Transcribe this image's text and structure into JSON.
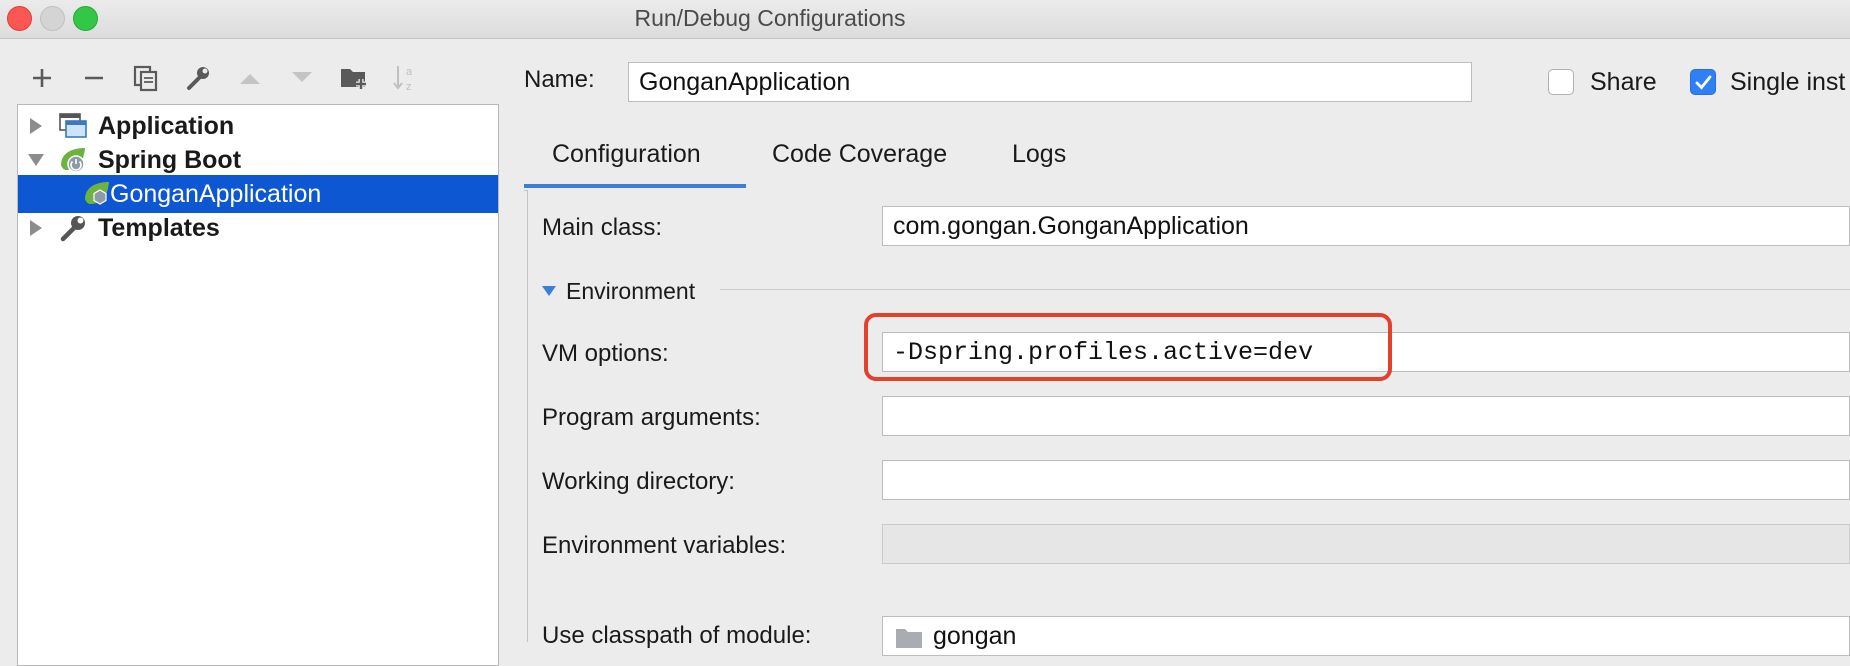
{
  "window": {
    "title": "Run/Debug Configurations"
  },
  "toolbar": {
    "buttons": [
      "add-icon",
      "remove-icon",
      "copy-icon",
      "wrench-icon",
      "move-up-icon",
      "move-down-icon",
      "new-folder-icon",
      "sort-icon"
    ]
  },
  "tree": {
    "items": [
      {
        "label": "Application",
        "expanded": false
      },
      {
        "label": "Spring Boot",
        "expanded": true
      },
      {
        "label": "GonganApplication",
        "selected": true
      },
      {
        "label": "Templates",
        "expanded": false
      }
    ]
  },
  "name": {
    "label": "Name:",
    "value": "GonganApplication"
  },
  "share": {
    "label": "Share",
    "checked": false
  },
  "single_instance": {
    "label": "Single inst",
    "checked": true
  },
  "tabs": [
    {
      "label": "Configuration",
      "active": true
    },
    {
      "label": "Code Coverage"
    },
    {
      "label": "Logs"
    }
  ],
  "config": {
    "main_class": {
      "label": "Main class:",
      "value": "com.gongan.GonganApplication"
    },
    "environment": {
      "label": "Environment"
    },
    "vm_options": {
      "label": "VM options:",
      "value": "-Dspring.profiles.active=dev"
    },
    "program_arguments": {
      "label": "Program arguments:",
      "value": ""
    },
    "working_directory": {
      "label": "Working directory:",
      "value": ""
    },
    "environment_variables": {
      "label": "Environment variables:",
      "value": ""
    },
    "classpath_module": {
      "label": "Use classpath of module:",
      "value": "gongan"
    }
  },
  "colors": {
    "selection": "#0d57d2",
    "highlight_box": "#e5402b",
    "spring_green": "#6db33f"
  }
}
